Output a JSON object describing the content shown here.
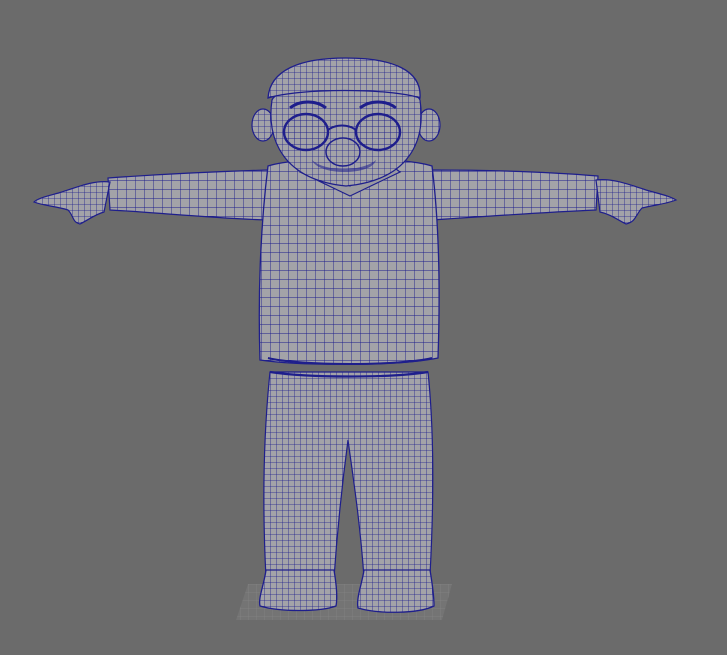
{
  "viewport": {
    "background": "#6b6b6b",
    "shading": "wireframe-on-shaded"
  },
  "model": {
    "name_icon": "character-tpose-model",
    "surface_color": "#a3a3a8",
    "surface_shadow": "#8a8a90",
    "wire_color": "#1e1e8c",
    "grid_color": "#8a8a8a"
  }
}
